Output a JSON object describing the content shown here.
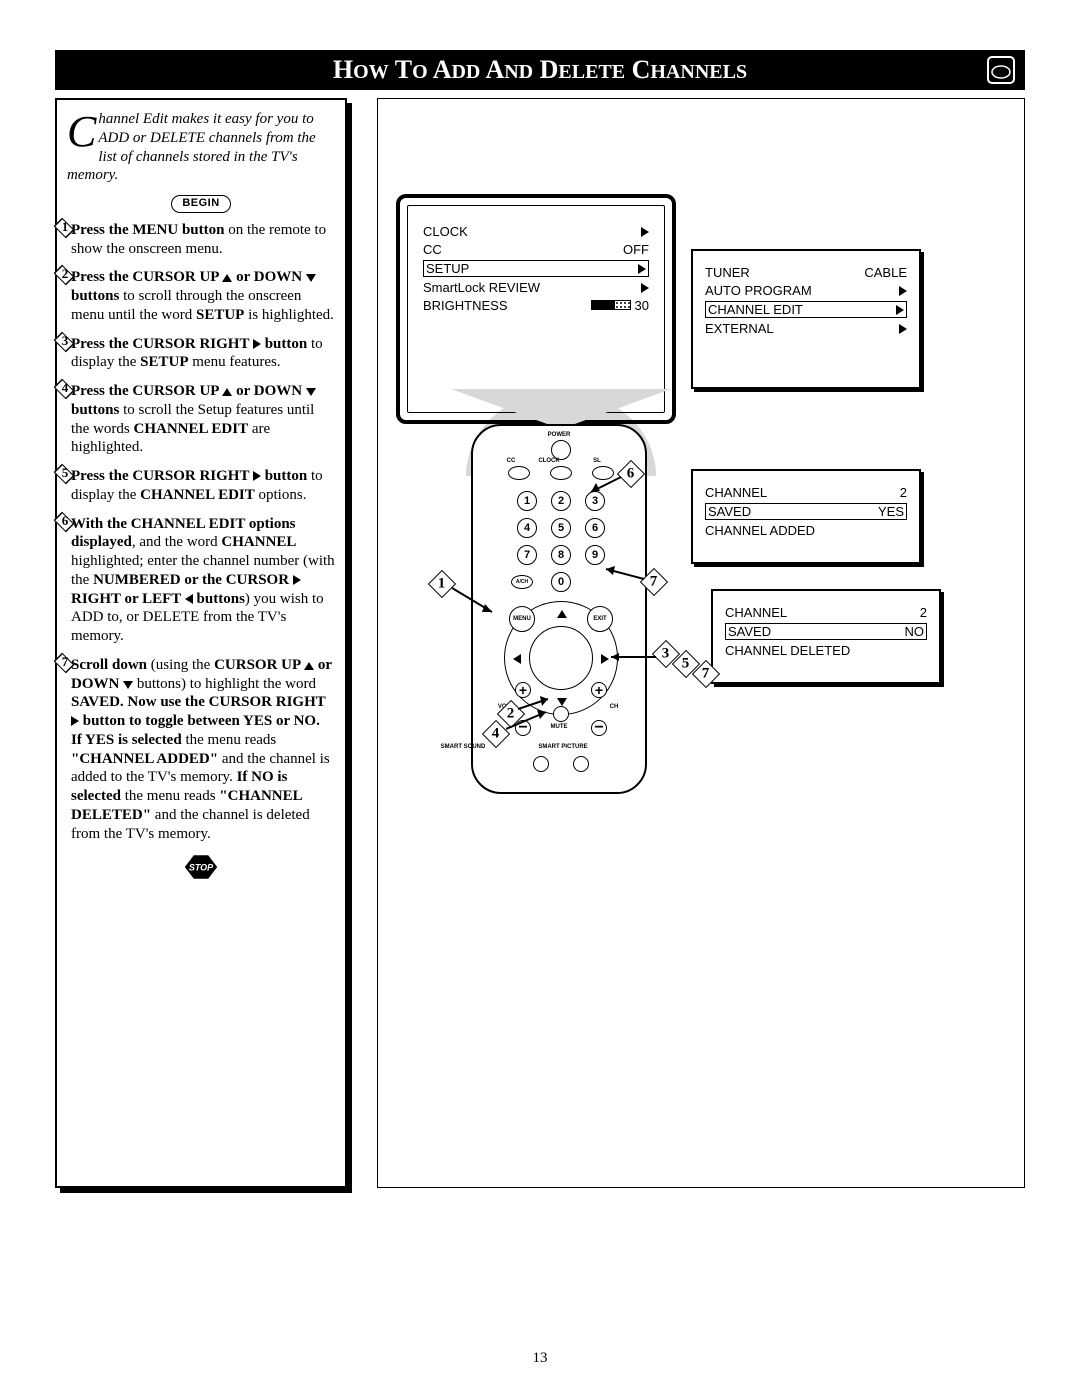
{
  "title_prefix": "H",
  "title_small1": "OW",
  "title_mid1": " T",
  "title_small2": "O",
  "title_mid2": " A",
  "title_small3": "DD",
  "title_mid3": " A",
  "title_small4": "ND",
  "title_mid4": " D",
  "title_small5": "ELETE",
  "title_mid5": " C",
  "title_small6": "HANNELS",
  "intro": {
    "dropcap": "C",
    "text": "hannel Edit makes it easy for you to ADD or DELETE channels from the list of channels stored in the TV's memory."
  },
  "begin_label": "BEGIN",
  "steps": {
    "s1": {
      "num": "1",
      "b1": "Press the MENU button",
      "t1": " on the remote to show the onscreen menu."
    },
    "s2": {
      "num": "2",
      "b1": "Press the CURSOR UP ",
      "b2": " or DOWN ",
      "b3": " buttons",
      "t1": " to scroll through the onscreen menu until the word ",
      "b4": "SETUP",
      "t2": " is highlighted."
    },
    "s3": {
      "num": "3",
      "b1": "Press the CURSOR RIGHT ",
      "b2": " button",
      "t1": " to display the ",
      "b3": "SETUP",
      "t2": " menu features."
    },
    "s4": {
      "num": "4",
      "b1": "Press the CURSOR UP ",
      "b2": " or DOWN ",
      "b3": " buttons",
      "t1": " to scroll the Setup features until the words ",
      "b4": "CHANNEL EDIT",
      "t2": " are highlighted."
    },
    "s5": {
      "num": "5",
      "b1": "Press the CURSOR RIGHT ",
      "b2": " button",
      "t1": " to display the ",
      "b3": "CHANNEL EDIT",
      "t2": " options."
    },
    "s6": {
      "num": "6",
      "b1": "With the CHANNEL EDIT options displayed",
      "t1": ", and the word ",
      "b2": "CHANNEL",
      "t2": " highlighted; enter the channel number (with the ",
      "b3": "NUMBERED or the CURSOR ",
      "b4": " RIGHT or LEFT ",
      "b5": " buttons",
      "t3": ") you wish to ADD to, or DELETE from the TV's memory."
    },
    "s7": {
      "num": "7",
      "b1": "Scroll down",
      "t1": " (using the ",
      "b2": "CURSOR UP ",
      "b3": " or DOWN ",
      "t2": " buttons) to highlight the word ",
      "b4": "SAVED. Now use the CURSOR RIGHT ",
      "b5": " button to toggle between YES or NO.",
      "line2a": "If YES is selected",
      "line2b": " the menu reads ",
      "line2c": "\"CHANNEL ADDED\"",
      "line2d": " and the channel is added to the TV's memory. ",
      "line2e": "If NO is selected",
      "line2f": " the menu reads ",
      "line2g": "\"CHANNEL DELETED\"",
      "line2h": " and the channel is deleted from the TV's memory."
    }
  },
  "stop_label": "STOP",
  "tv_menu": {
    "r1": {
      "label": "CLOCK"
    },
    "r2": {
      "label": "CC",
      "val": "OFF"
    },
    "r3": {
      "label": "SETUP"
    },
    "r4": {
      "label": "SmartLock REVIEW"
    },
    "r5": {
      "label": "BRIGHTNESS",
      "val": "30"
    }
  },
  "osd1": {
    "r1": {
      "label": "TUNER",
      "val": "CABLE"
    },
    "r2": {
      "label": "AUTO PROGRAM"
    },
    "r3": {
      "label": "CHANNEL EDIT"
    },
    "r4": {
      "label": "EXTERNAL"
    }
  },
  "osd2": {
    "r1": {
      "label": "CHANNEL",
      "val": "2"
    },
    "r2": {
      "label": "SAVED",
      "val": "YES"
    },
    "r3": {
      "label": "CHANNEL ADDED"
    }
  },
  "osd3": {
    "r1": {
      "label": "CHANNEL",
      "val": "2"
    },
    "r2": {
      "label": "SAVED",
      "val": "NO"
    },
    "r3": {
      "label": "CHANNEL DELETED"
    }
  },
  "remote": {
    "power": "POWER",
    "cc": "CC",
    "clock": "CLOCK",
    "sl": "SL",
    "ach": "A/CH",
    "menu": "MENU",
    "exit": "EXIT",
    "vol": "VOL",
    "ch": "CH",
    "mute": "MUTE",
    "ss": "SMART SOUND",
    "sp": "SMART PICTURE",
    "nums": [
      "1",
      "2",
      "3",
      "4",
      "5",
      "6",
      "7",
      "8",
      "9",
      "0"
    ]
  },
  "callouts": {
    "c1": "1",
    "c2": "2",
    "c3": "3",
    "c4": "4",
    "c5": "5",
    "c6": "6",
    "c7": "7",
    "c7b": "7"
  },
  "page_number": "13"
}
